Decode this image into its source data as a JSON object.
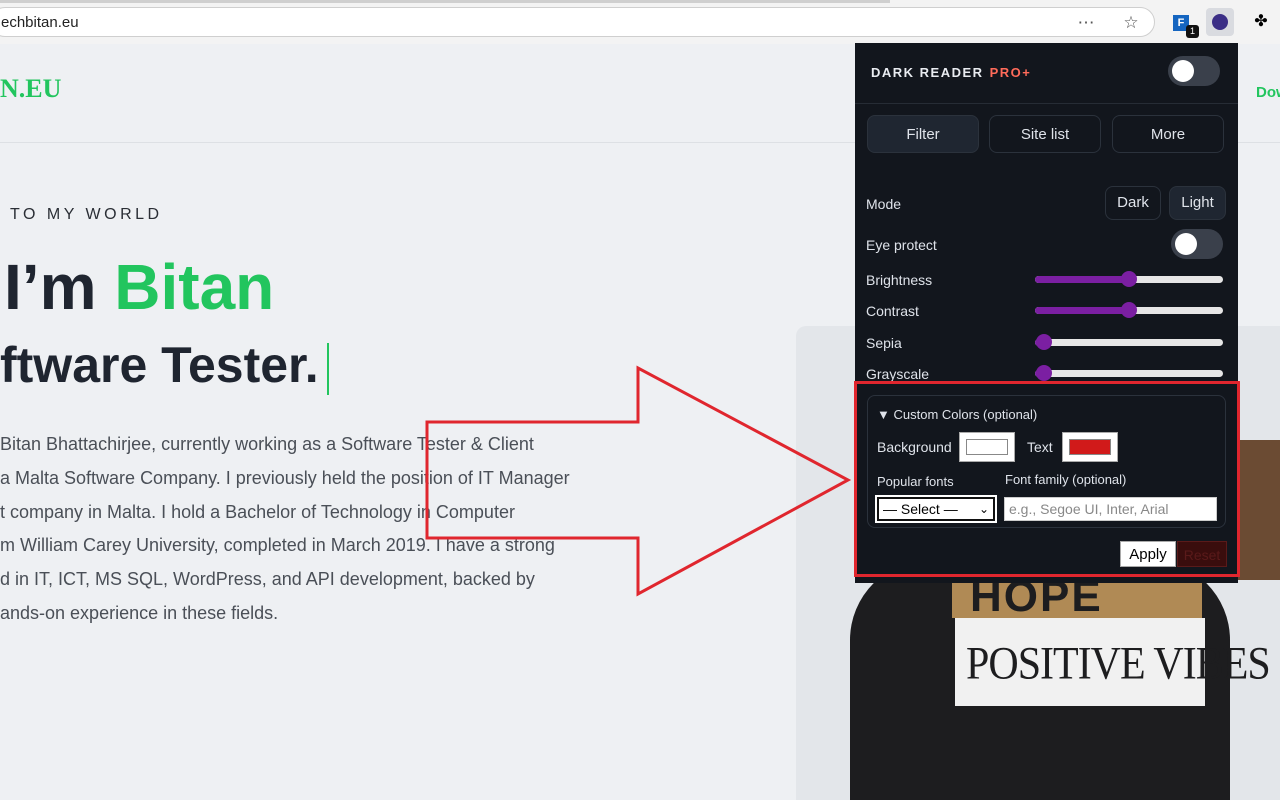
{
  "browser": {
    "url": "echbitan.eu",
    "icons": [
      "more-options-icon",
      "star-icon",
      "extension-icon",
      "dark-reader-icon",
      "puzzle-icon"
    ],
    "badge_count": "1"
  },
  "site": {
    "logo": "N.EU",
    "nav_partial": "Dow",
    "welcome": "TO MY WORLD",
    "hero_prefix": "I’m ",
    "hero_name": "Bitan",
    "hero_role": "ftware Tester.",
    "bio_lines": [
      "Bitan Bhattachirjee, currently working as a Software Tester & Client",
      "a Malta Software Company. I previously held the position of IT Manager",
      "t company in Malta. I hold a Bachelor of Technology in Computer",
      "m William Carey University, completed in March 2019. I have a strong",
      "d in IT, ICT, MS SQL, WordPress, and API development, backed by",
      "ands-on experience in these fields."
    ],
    "hoodie_top": "HOPE",
    "hoodie_text": "POSITIVE VIBES",
    "accent": "#22c55e"
  },
  "popup": {
    "brand": "DARK READER",
    "brand_pro": "PRO+",
    "tabs": [
      "Filter",
      "Site list",
      "More"
    ],
    "mode_label": "Mode",
    "mode_dark": "Dark",
    "mode_light": "Light",
    "eye_protect": "Eye protect",
    "sliders": [
      {
        "label": "Brightness",
        "value": 0.5
      },
      {
        "label": "Contrast",
        "value": 0.5
      },
      {
        "label": "Sepia",
        "value": 0.05
      },
      {
        "label": "Grayscale",
        "value": 0.05
      }
    ],
    "custom_title": "▼ Custom Colors (optional)",
    "background_label": "Background",
    "background_color": "#ffffff",
    "text_label": "Text",
    "text_color": "#d11a1a",
    "popular_fonts_label": "Popular fonts",
    "font_family_label": "Font family (optional)",
    "select_value": "— Select —",
    "font_placeholder": "e.g., Segoe UI, Inter, Arial",
    "apply": "Apply",
    "reset": "Reset",
    "slider_color": "#7b1fa2"
  },
  "annotation": {
    "highlight_color": "#e0262e"
  }
}
